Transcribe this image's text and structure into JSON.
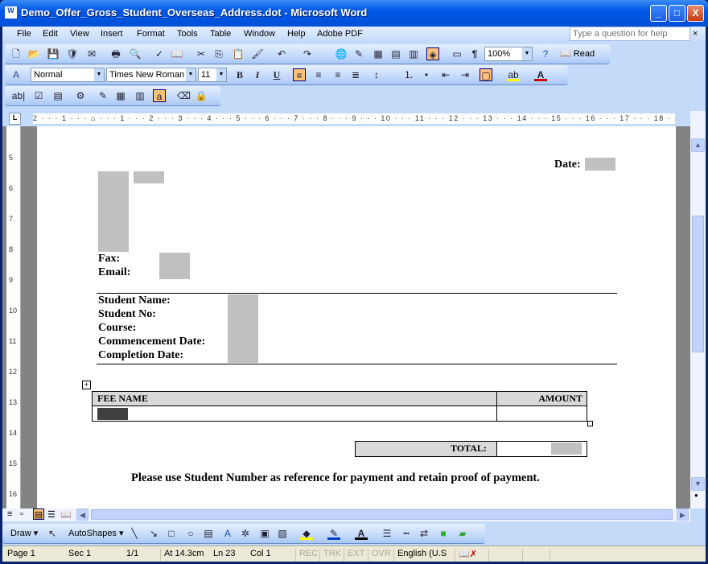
{
  "window": {
    "title": "Demo_Offer_Gross_Student_Overseas_Address.dot - Microsoft Word",
    "minimize": "_",
    "maximize": "□",
    "close": "X"
  },
  "menu": [
    "File",
    "Edit",
    "View",
    "Insert",
    "Format",
    "Tools",
    "Table",
    "Window",
    "Help",
    "Adobe PDF"
  ],
  "help_placeholder": "Type a question for help",
  "standard_toolbar": {
    "zoom": "100%",
    "read_label": "Read",
    "pilcrow": "¶"
  },
  "formatting_toolbar": {
    "style": "Normal",
    "font": "Times New Roman",
    "size": "11",
    "bold": "B",
    "italic": "I",
    "underline": "U"
  },
  "forms_toolbar": {
    "textfield": "ab|"
  },
  "ruler": {
    "text": "2 · · · 1 · · · ⌂ · · · 1 · · · 2 · · · 3 · · · 4 · · · 5 · · · 6 · · · 7 · · · 8 · · · 9 · · · 10 · · · 11 · · · 12 · · · 13 · · · 14 · · · 15 · · · 16 · · · 17 · · · 18 · ·"
  },
  "vertical_ruler": [
    "5",
    "6",
    "7",
    "8",
    "9",
    "10",
    "11",
    "12",
    "13",
    "14",
    "15",
    "16"
  ],
  "document": {
    "date_label": "Date:",
    "fax_label": "Fax:",
    "email_label": "Email:",
    "student_fields": [
      "Student Name:",
      "Student No:",
      "Course:",
      "Commencement Date:",
      "Completion Date:"
    ],
    "fee_table": {
      "headers": [
        "FEE NAME",
        "AMOUNT"
      ]
    },
    "total_label": "TOTAL:",
    "footer_note": "Please use Student Number as reference for payment and retain proof of payment."
  },
  "draw_toolbar": {
    "draw": "Draw ▾",
    "autoshapes": "AutoShapes ▾"
  },
  "status": {
    "page": "Page 1",
    "sec": "Sec 1",
    "pages": "1/1",
    "at": "At 14.3cm",
    "ln": "Ln 23",
    "col": "Col 1",
    "rec": "REC",
    "trk": "TRK",
    "ext": "EXT",
    "ovr": "OVR",
    "language": "English (U.S"
  }
}
